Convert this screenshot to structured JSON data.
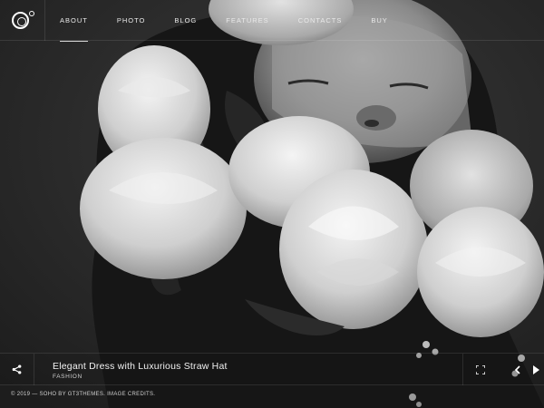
{
  "header": {
    "nav": [
      {
        "label": "ABOUT",
        "active": true
      },
      {
        "label": "PHOTO"
      },
      {
        "label": "BLOG"
      },
      {
        "label": "FEATURES"
      },
      {
        "label": "CONTACTS"
      },
      {
        "label": "BUY"
      }
    ]
  },
  "slide": {
    "title": "Elegant Dress with Luxurious Straw Hat",
    "category": "FASHION"
  },
  "icons": {
    "logo": "soho-logo-icon",
    "share": "share-icon",
    "fullscreen": "fullscreen-icon",
    "prev": "chevron-left-icon",
    "next": "play-next-icon"
  },
  "footer": {
    "text": "© 2019 — SOHO BY GT3THEMES. IMAGE CREDITS."
  }
}
